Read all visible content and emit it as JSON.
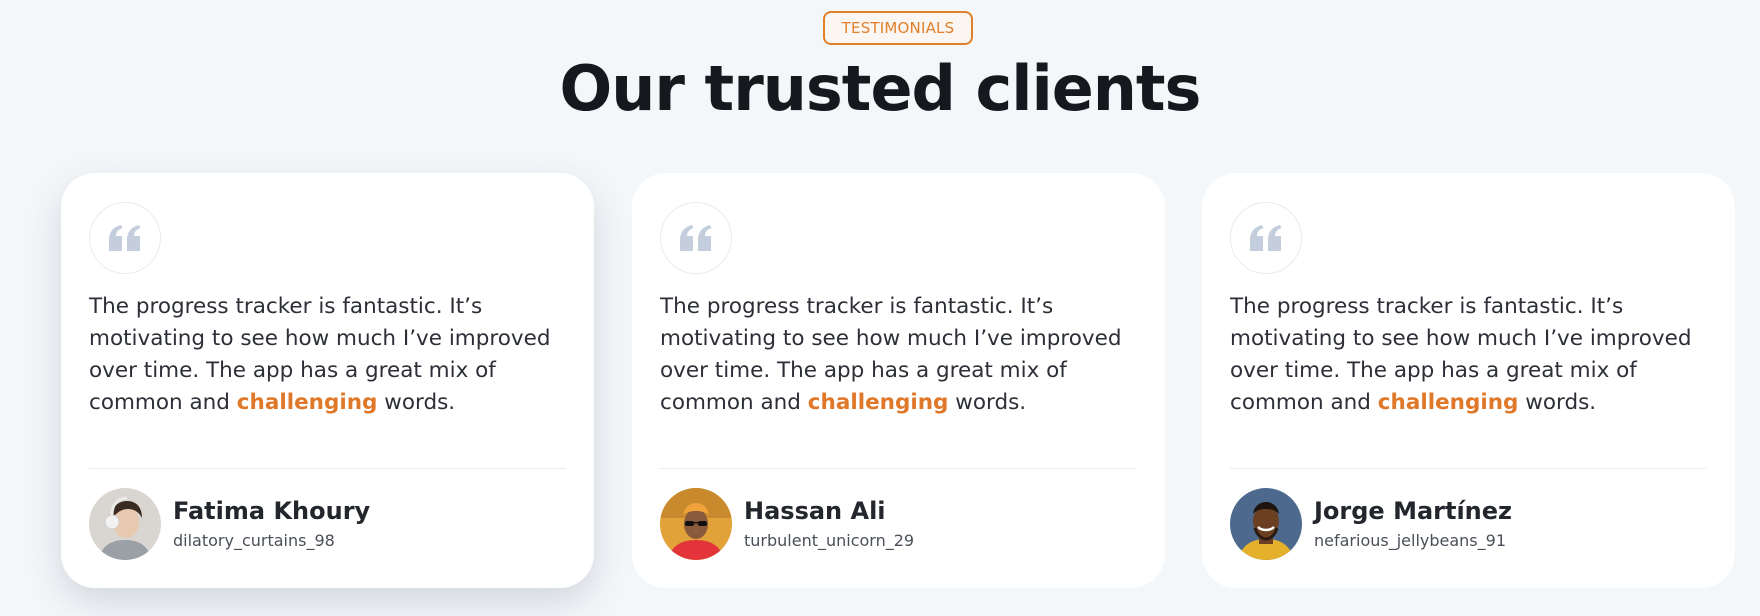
{
  "header": {
    "badge": "TESTIMONIALS",
    "title": "Our trusted clients"
  },
  "colors": {
    "accent": "#e0802c",
    "background": "#f4f7fa",
    "card": "#ffffff",
    "quote_icon": "#c5cedd"
  },
  "testimonials": [
    {
      "quote_icon": "quote-icon",
      "text_before": "The progress tracker is fantastic. It’s motivating to see how much I’ve improved over time. The app has a great mix of common and ",
      "highlight": "challenging",
      "text_after": " words.",
      "name": "Fatima Khoury",
      "handle": "dilatory_curtains_98",
      "avatar": "avatar-woman-headphones"
    },
    {
      "quote_icon": "quote-icon",
      "text_before": "The progress tracker is fantastic. It’s motivating to see how much I’ve improved over time. The app has a great mix of common and ",
      "highlight": "challenging",
      "text_after": " words.",
      "name": "Hassan Ali",
      "handle": "turbulent_unicorn_29",
      "avatar": "avatar-man-sunglasses"
    },
    {
      "quote_icon": "quote-icon",
      "text_before": "The progress tracker is fantastic. It’s motivating to see how much I’ve improved over time. The app has a great mix of common and ",
      "highlight": "challenging",
      "text_after": " words.",
      "name": "Jorge Martínez",
      "handle": "nefarious_jellybeans_91",
      "avatar": "avatar-man-smiling"
    }
  ]
}
